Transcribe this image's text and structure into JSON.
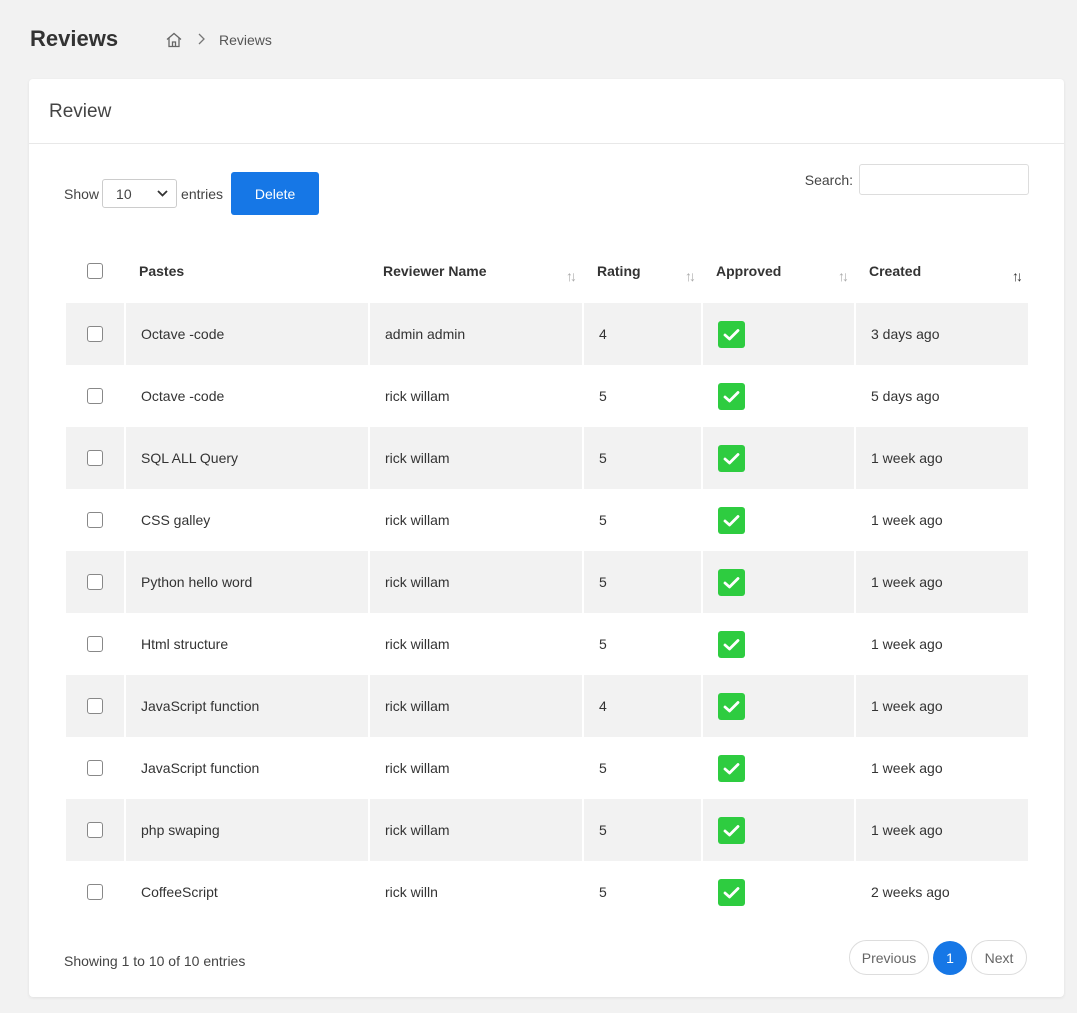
{
  "header": {
    "title": "Reviews",
    "breadcrumb": {
      "home_icon": "home-icon",
      "separator_icon": "chevron-right-icon",
      "current": "Reviews"
    }
  },
  "card": {
    "title": "Review"
  },
  "controls": {
    "show_label": "Show",
    "entries_label": "entries",
    "page_length": "10",
    "delete_label": "Delete",
    "search_label": "Search:",
    "search_value": ""
  },
  "table": {
    "columns": [
      "Pastes",
      "Reviewer Name",
      "Rating",
      "Approved",
      "Created"
    ],
    "rows": [
      {
        "paste": "Octave -code",
        "reviewer": "admin admin",
        "rating": "4",
        "approved": true,
        "created": "3 days ago"
      },
      {
        "paste": "Octave -code",
        "reviewer": "rick willam",
        "rating": "5",
        "approved": true,
        "created": "5 days ago"
      },
      {
        "paste": "SQL ALL Query",
        "reviewer": "rick willam",
        "rating": "5",
        "approved": true,
        "created": "1 week ago"
      },
      {
        "paste": "CSS galley",
        "reviewer": "rick willam",
        "rating": "5",
        "approved": true,
        "created": "1 week ago"
      },
      {
        "paste": "Python hello word",
        "reviewer": "rick willam",
        "rating": "5",
        "approved": true,
        "created": "1 week ago"
      },
      {
        "paste": "Html structure",
        "reviewer": "rick willam",
        "rating": "5",
        "approved": true,
        "created": "1 week ago"
      },
      {
        "paste": "JavaScript function",
        "reviewer": "rick willam",
        "rating": "4",
        "approved": true,
        "created": "1 week ago"
      },
      {
        "paste": "JavaScript function",
        "reviewer": "rick willam",
        "rating": "5",
        "approved": true,
        "created": "1 week ago"
      },
      {
        "paste": "php swaping",
        "reviewer": "rick willam",
        "rating": "5",
        "approved": true,
        "created": "1 week ago"
      },
      {
        "paste": "CoffeeScript",
        "reviewer": "rick willn",
        "rating": "5",
        "approved": true,
        "created": "2 weeks ago"
      }
    ]
  },
  "footer": {
    "info": "Showing 1 to 10 of 10 entries",
    "previous_label": "Previous",
    "current_page": "1",
    "next_label": "Next"
  },
  "colors": {
    "primary": "#1677e6",
    "approved": "#2ecc40",
    "stripe": "#f2f2f2"
  }
}
